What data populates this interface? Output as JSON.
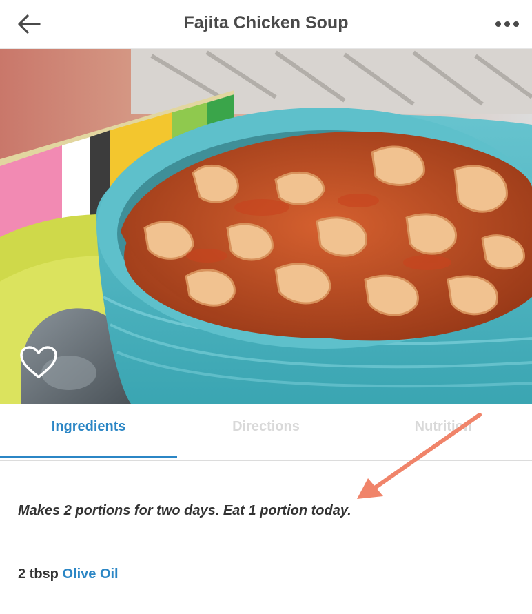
{
  "header": {
    "title": "Fajita Chicken Soup",
    "back_icon": "arrow-left-icon",
    "more_icon": "more-horizontal-icon"
  },
  "hero": {
    "image_description_icon": "soup-photo",
    "favorite_icon": "heart-outline-icon",
    "pager": {
      "pages": 1,
      "current": 1
    }
  },
  "tabs": [
    {
      "label": "Ingredients",
      "active": true
    },
    {
      "label": "Directions",
      "active": false
    },
    {
      "label": "Nutrition",
      "active": false
    }
  ],
  "content": {
    "portions_note": "Makes 2 portions for two days. Eat 1 portion today.",
    "ingredients": [
      {
        "quantity": "2 tbsp",
        "name": "Olive Oil"
      }
    ]
  },
  "colors": {
    "accent": "#2b86c5",
    "title_text": "#4a4a4a",
    "body_text": "#333333",
    "inactive_tab": "#d9d9d9",
    "annotation_arrow": "#f0846a"
  }
}
